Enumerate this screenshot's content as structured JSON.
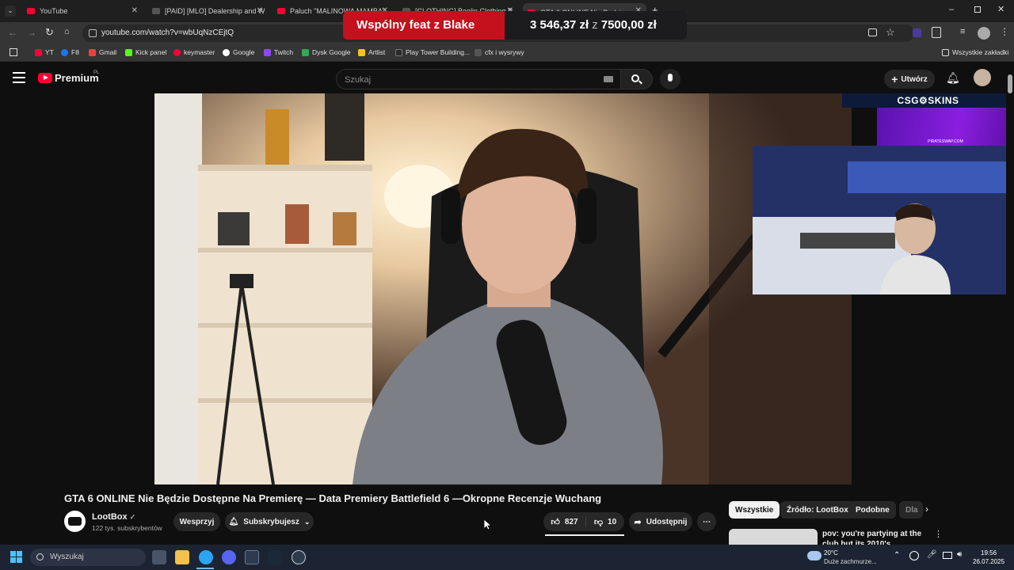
{
  "browser": {
    "tabs": [
      {
        "label": "YouTube",
        "active": false
      },
      {
        "label": "[PAID] [MLO] Dealership and W",
        "active": false
      },
      {
        "label": "Paluch \"MALINOWA MAMBA\"",
        "active": false
      },
      {
        "label": "[CLOTHING] Boolin Clothing P",
        "active": false
      },
      {
        "label": "GTA 6 ONLINE Nie Będzie D",
        "active": true
      }
    ],
    "url": "youtube.com/watch?v=wbUqNzCEjtQ",
    "bookmarks": [
      "YT",
      "F8",
      "Gmail",
      "Kick panel",
      "keymaster",
      "Google",
      "Twitch",
      "Dysk Google",
      "Artlist",
      "Play Tower Building...",
      "cfx i wysrywy"
    ],
    "all_bookmarks_label": "Wszystkie zakładki"
  },
  "donation_overlay": {
    "title": "Wspólny feat z Blake",
    "current": "3 546,37 zł",
    "separator": "z",
    "goal": "7500,00 zł"
  },
  "youtube": {
    "logo_text": "Premium",
    "logo_region": "PL",
    "search_placeholder": "Szukaj",
    "create_label": "Utwórz",
    "stream_overlay": {
      "logo": "CSG⚙SKINS",
      "banner_text": "PIRATESWAP.COM"
    },
    "video": {
      "title": "GTA 6 ONLINE Nie Będzie Dostępne Na Premierę — Data Premiery Battlefield 6 —Okropne Recenzje Wuchang",
      "channel_name": "LootBox",
      "subscribers": "122 tys. subskrybentów",
      "support_label": "Wesprzyj",
      "subscribed_label": "Subskrybujesz",
      "likes": "827",
      "dislikes": "10",
      "share_label": "Udostępnij"
    },
    "chips": [
      "Wszystkie",
      "Źródło: LootBox",
      "Podobne",
      "Dla"
    ],
    "suggestion_title": "pov: you're partying at the club but its 2010's"
  },
  "taskbar": {
    "search_label": "Wyszukaj",
    "weather_temp": "20°C",
    "weather_desc": "Duże zachmurze...",
    "time": "19:56",
    "date": "26.07.2025"
  },
  "colors": {
    "yt_red": "#ff0033",
    "donation_red": "#c4111d",
    "bg": "#0f0f0f"
  }
}
